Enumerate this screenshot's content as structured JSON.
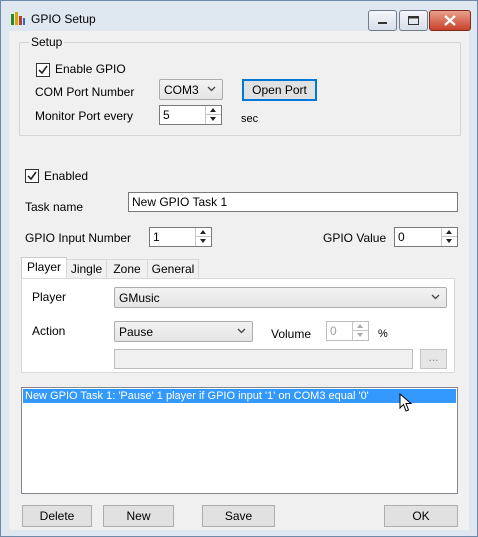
{
  "window": {
    "title": "GPIO Setup",
    "controls": [
      "minimize",
      "maximize",
      "close"
    ],
    "accent": "#3399ff"
  },
  "setup": {
    "group_title": "Setup",
    "enable_gpio_label": "Enable GPIO",
    "enable_gpio_checked": true,
    "com_port_label": "COM Port Number",
    "com_port_value": "COM3",
    "open_port_label": "Open Port",
    "monitor_label": "Monitor Port every",
    "monitor_value": "5",
    "monitor_unit": "sec"
  },
  "task": {
    "enabled_label": "Enabled",
    "enabled_checked": true,
    "name_label": "Task name",
    "name_value": "New GPIO Task 1",
    "input_number_label": "GPIO Input Number",
    "input_number_value": "1",
    "gpio_value_label": "GPIO Value",
    "gpio_value_value": "0"
  },
  "tabs": [
    {
      "label": "Player",
      "active": true
    },
    {
      "label": "Jingle",
      "active": false
    },
    {
      "label": "Zone",
      "active": false
    },
    {
      "label": "General",
      "active": false
    }
  ],
  "player_tab": {
    "player_label": "Player",
    "player_value": "GMusic",
    "action_label": "Action",
    "action_value": "Pause",
    "volume_label": "Volume",
    "volume_value": "0",
    "volume_unit": "%",
    "path_value": "",
    "browse_label": "..."
  },
  "task_list": [
    {
      "text": "New GPIO Task 1: 'Pause' 1 player if GPIO input '1' on COM3 equal '0'",
      "selected": true
    }
  ],
  "footer": {
    "delete_label": "Delete",
    "new_label": "New",
    "save_label": "Save",
    "ok_label": "OK"
  }
}
